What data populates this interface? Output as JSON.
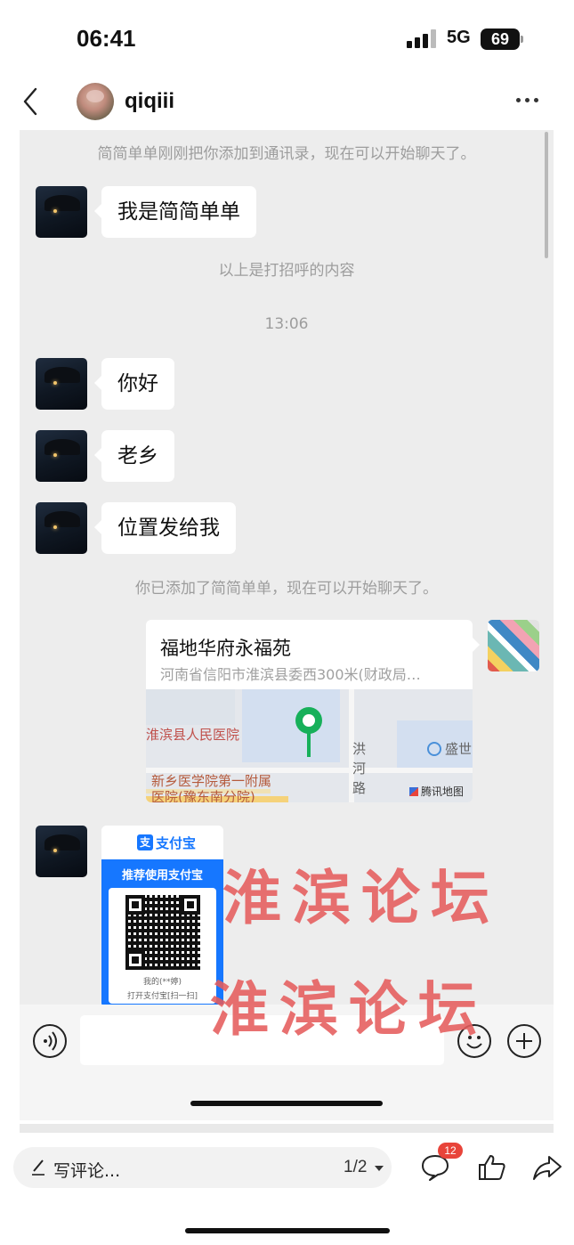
{
  "status_bar": {
    "time": "06:41",
    "network": "5G",
    "battery": "69"
  },
  "header": {
    "contact_name": "qiqiii"
  },
  "chat": {
    "sys_added_by_contact": "简简单单刚刚把你添加到通讯录，现在可以开始聊天了。",
    "msg_1": "我是简简单单",
    "sys_greeting_note": "以上是打招呼的内容",
    "timestamp": "13:06",
    "msg_2": "你好",
    "msg_3": "老乡",
    "msg_4": "位置发给我",
    "sys_you_added": "你已添加了简简单单，现在可以开始聊天了。",
    "location": {
      "title": "福地华府永福苑",
      "address": "河南省信阳市淮滨县委西300米(财政局…",
      "map_labels": {
        "hospital": "淮滨县人民医院",
        "hongh_road": [
          "洪",
          "河",
          "路"
        ],
        "shengshi": "盛世",
        "xinxiang": "新乡医学院第一附属",
        "xinxiang_2": "医院(豫东南分院)",
        "brand": "腾讯地图"
      }
    },
    "alipay": {
      "brand": "支付宝",
      "logo_char": "支",
      "banner": "推荐使用支付宝",
      "qr_caption": "我的(**婷)",
      "scan_hint": "打开支付宝[扫一扫]"
    }
  },
  "watermark": {
    "line_1": "淮滨论坛",
    "line_2": "淮滨论坛"
  },
  "bottom_bar": {
    "comment_placeholder": "写评论...",
    "page_indicator": "1/2",
    "comment_badge": "12"
  },
  "icons": {
    "back": "chevron-left-icon",
    "more": "more-dots-icon",
    "voice": "voice-icon",
    "emoji": "emoji-icon",
    "plus": "plus-icon",
    "pen": "pen-icon",
    "comment": "comment-icon",
    "like": "thumbs-up-icon",
    "share": "share-icon"
  },
  "colors": {
    "chat_bg": "#ededed",
    "alipay_blue": "#1677ff",
    "watermark": "#e55c5c",
    "badge": "#e8443a",
    "map_pin": "#17b05a"
  }
}
